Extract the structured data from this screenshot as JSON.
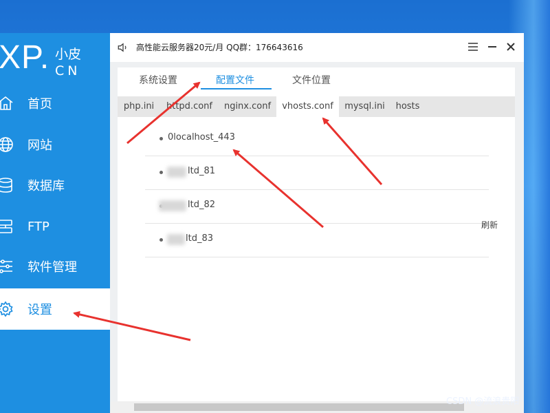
{
  "app": {
    "logo_main": "XP.",
    "logo_cn_top": "小皮",
    "logo_cn_bottom": "CN",
    "title": "高性能云服务器20元/月  QQ群：176643616"
  },
  "sidebar": {
    "items": [
      {
        "label": "首页",
        "icon": "home-icon"
      },
      {
        "label": "网站",
        "icon": "globe-icon"
      },
      {
        "label": "数据库",
        "icon": "database-icon"
      },
      {
        "label": "FTP",
        "icon": "server-icon"
      },
      {
        "label": "软件管理",
        "icon": "sliders-icon"
      },
      {
        "label": "设置",
        "icon": "gear-icon",
        "active": true
      }
    ]
  },
  "tabs": {
    "top": [
      {
        "label": "系统设置"
      },
      {
        "label": "配置文件",
        "active": true
      },
      {
        "label": "文件位置"
      }
    ],
    "sub": [
      {
        "label": "php.ini"
      },
      {
        "label": "httpd.conf"
      },
      {
        "label": "nginx.conf"
      },
      {
        "label": "vhosts.conf",
        "active": true
      },
      {
        "label": "mysql.ini"
      },
      {
        "label": "hosts"
      }
    ]
  },
  "vhosts": [
    {
      "name": "0localhost_443"
    },
    {
      "name": "ltd_81"
    },
    {
      "name": "ltd_82"
    },
    {
      "name": "ltd_83"
    }
  ],
  "actions": {
    "refresh_label": "刷新"
  },
  "watermark": "CSDN @流浪贵阳",
  "colors": {
    "accent": "#1e8fe1",
    "annotation": "#e8322e"
  }
}
